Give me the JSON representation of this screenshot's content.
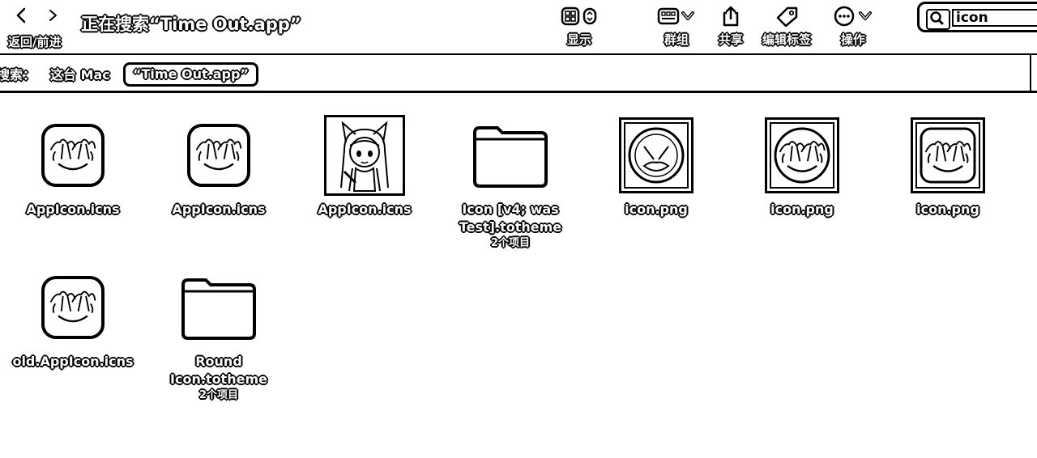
{
  "window": {
    "title": "正在搜索“Time Out.app”",
    "nav_label": "返回/前进"
  },
  "toolbar": {
    "view_label": "显示",
    "group_label": "群组",
    "share_label": "共享",
    "tags_label": "编辑标签",
    "action_label": "操作"
  },
  "search": {
    "value": "icon"
  },
  "scope": {
    "label": "搜索：",
    "this_mac": "这台 Mac",
    "app": "“Time Out.app”"
  },
  "icons": {
    "back": "chevron-left-icon",
    "forward": "chevron-right-icon",
    "view": "grid-view-icon",
    "group": "group-icon",
    "share": "share-icon",
    "tags": "tag-icon",
    "action": "ellipsis-circle-icon",
    "search": "magnifier-icon"
  },
  "files": [
    {
      "name": "AppIcon.icns",
      "kind": "palm-app-icon"
    },
    {
      "name": "AppIcon.icns",
      "kind": "palm-app-icon"
    },
    {
      "name": "AppIcon.icns",
      "kind": "anime-girl-image"
    },
    {
      "name": "Icon [v4; was Test].totheme",
      "kind": "folder",
      "count": "2个项目"
    },
    {
      "name": "icon.png",
      "kind": "face-circle-image"
    },
    {
      "name": "icon.png",
      "kind": "palm-circle-image"
    },
    {
      "name": "icon.png",
      "kind": "palm-square-image"
    },
    {
      "name": "old.AppIcon.icns",
      "kind": "palm-app-icon"
    },
    {
      "name": "Round Icon.totheme",
      "kind": "folder",
      "count": "2个项目"
    }
  ]
}
